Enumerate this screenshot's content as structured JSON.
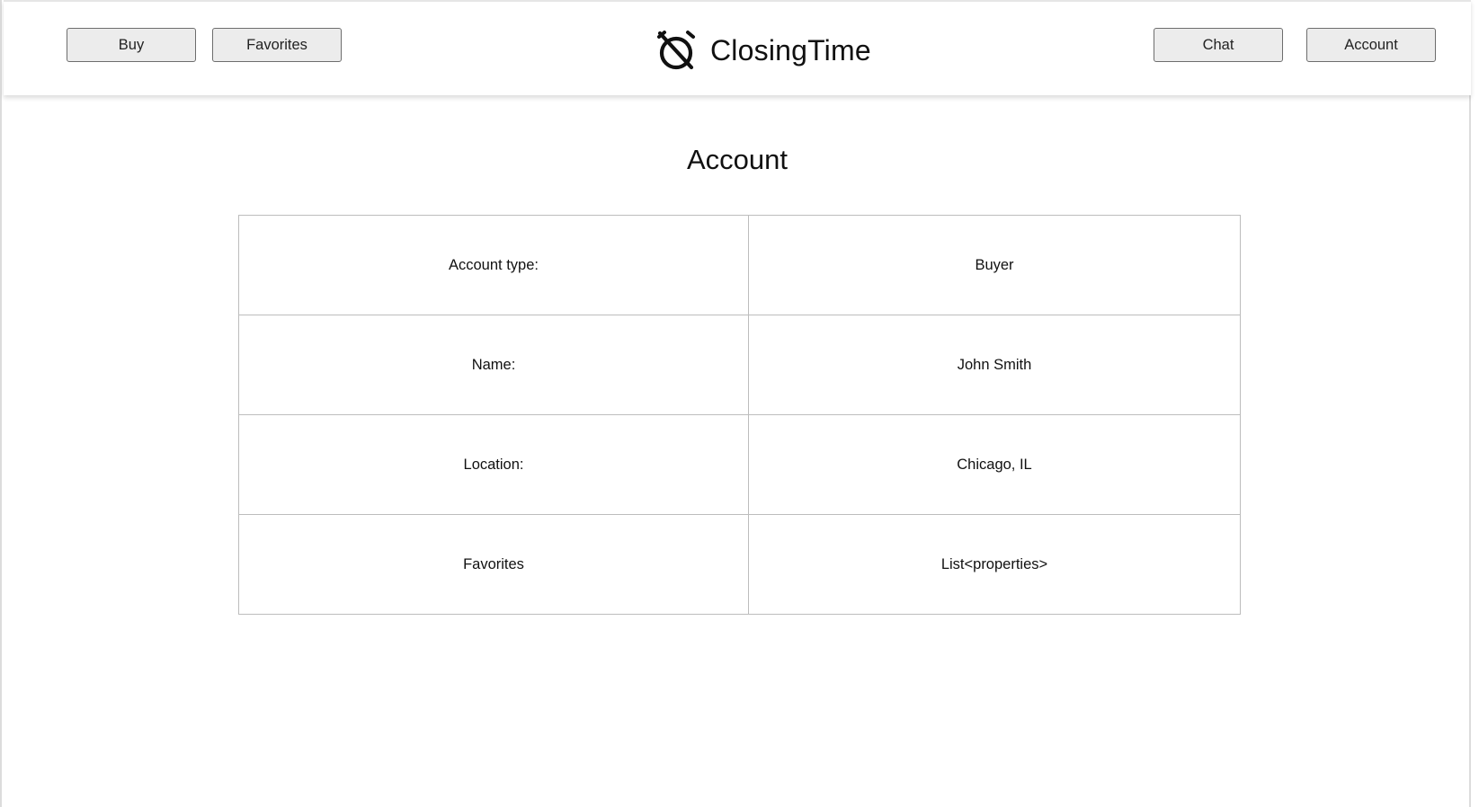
{
  "header": {
    "nav_left": {
      "buy_label": "Buy",
      "favorites_label": "Favorites"
    },
    "brand": {
      "name": "ClosingTime",
      "icon": "alarm-off-icon"
    },
    "nav_right": {
      "chat_label": "Chat",
      "account_label": "Account"
    }
  },
  "main": {
    "title": "Account",
    "rows": [
      {
        "label": "Account type:",
        "value": "Buyer"
      },
      {
        "label": "Name:",
        "value": "John Smith"
      },
      {
        "label": "Location:",
        "value": "Chicago, IL"
      },
      {
        "label": "Favorites",
        "value": "List<properties>"
      }
    ]
  },
  "colors": {
    "button_fill": "#ececec",
    "button_border": "#6d6d6d",
    "table_border": "#bdbdbd",
    "text": "#111111"
  }
}
